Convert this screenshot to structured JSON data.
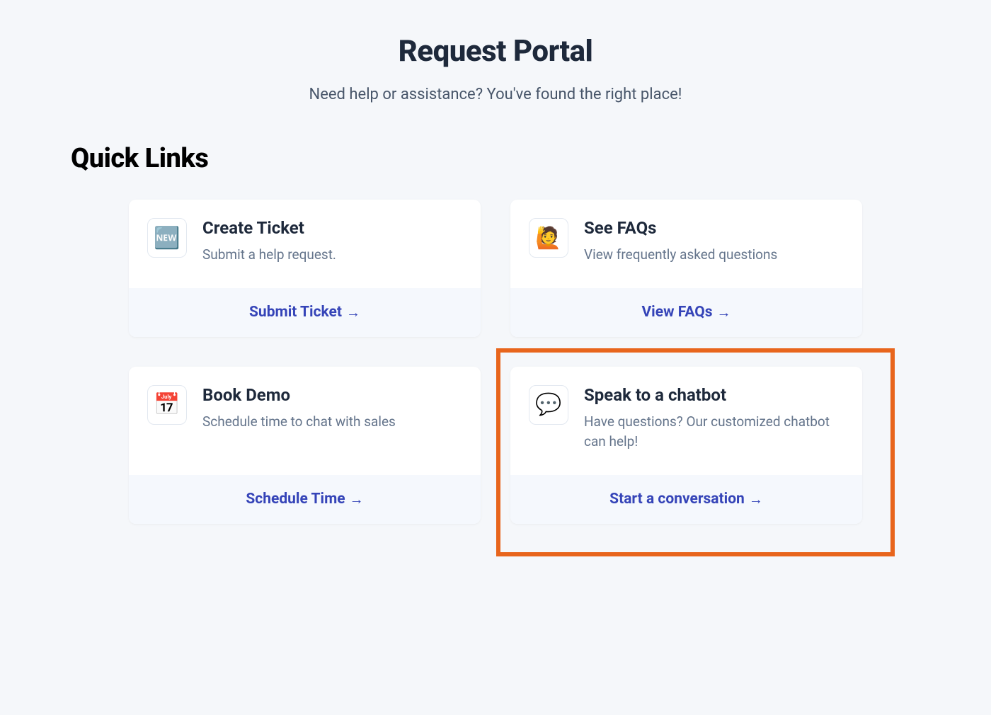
{
  "header": {
    "title": "Request Portal",
    "subtitle": "Need help or assistance? You've found the right place!"
  },
  "section": {
    "title": "Quick Links"
  },
  "cards": [
    {
      "icon": "🆕",
      "title": "Create Ticket",
      "desc": "Submit a help request.",
      "action": "Submit Ticket"
    },
    {
      "icon": "🙋",
      "title": "See FAQs",
      "desc": "View frequently asked questions",
      "action": "View FAQs"
    },
    {
      "icon": "📅",
      "title": "Book Demo",
      "desc": "Schedule time to chat with sales",
      "action": "Schedule Time"
    },
    {
      "icon": "💬",
      "title": "Speak to a chatbot",
      "desc": "Have questions? Our customized chatbot can help!",
      "action": "Start a conversation"
    }
  ],
  "arrow": "→"
}
